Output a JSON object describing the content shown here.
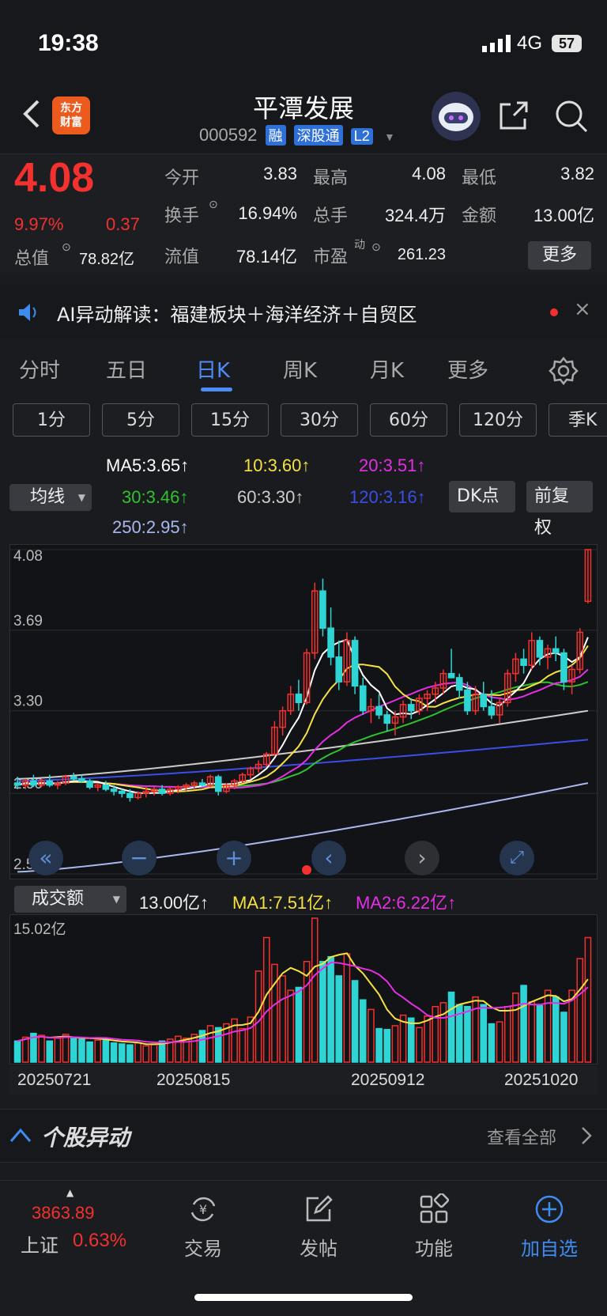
{
  "status": {
    "time": "19:38",
    "network": "4G",
    "battery": "57"
  },
  "header": {
    "back_icon": "chevron-left-icon",
    "logo_line1": "东方",
    "logo_line2": "财富",
    "title": "平潭发展",
    "code": "000592",
    "tags": [
      "融",
      "深股通",
      "L2"
    ]
  },
  "quote": {
    "price": "4.08",
    "change_pct": "9.97%",
    "change": "0.37",
    "open_label": "今开",
    "open": "3.83",
    "high_label": "最高",
    "high": "4.08",
    "low_label": "最低",
    "low": "3.82",
    "turnover_label": "换手",
    "turnover": "16.94%",
    "volume_label": "总手",
    "volume": "324.4万",
    "amount_label": "金额",
    "amount": "13.00亿",
    "mktcap_label": "总值",
    "mktcap": "78.82亿",
    "float_label": "流值",
    "float": "78.14亿",
    "pe_label": "市盈",
    "pe_sup": "动",
    "pe": "261.23",
    "more": "更多"
  },
  "ai": {
    "text": "AI异动解读：福建板块＋海洋经济＋自贸区"
  },
  "tabs": [
    "分时",
    "五日",
    "日K",
    "周K",
    "月K",
    "更多"
  ],
  "periods": [
    "1分",
    "5分",
    "15分",
    "30分",
    "60分",
    "120分",
    "季K"
  ],
  "ma": {
    "selector": "均线",
    "ma5": "MA5:3.65↑",
    "ma10": "10:3.60↑",
    "ma20": "20:3.51↑",
    "ma30": "30:3.46↑",
    "ma60": "60:3.30↑",
    "ma120": "120:3.16↑",
    "ma250": "250:2.95↑",
    "dk": "DK点",
    "fq": "前复权"
  },
  "colors": {
    "up": "#f3312e",
    "down": "#2ed5d5",
    "ma5": "#ffffff",
    "ma10": "#f5e142",
    "ma20": "#e62ee6",
    "ma30": "#2ec22e",
    "ma60": "#cccccc",
    "ma120": "#3a4ee8",
    "ma250": "#aab8f0",
    "accent": "#4e8cf5"
  },
  "chart_data": [
    {
      "type": "candlestick",
      "ylim": [
        2.51,
        4.08
      ],
      "y_ticks": [
        "4.08",
        "3.69",
        "3.30",
        "2.90",
        "2.51"
      ],
      "ohlc": [
        [
          2.95,
          2.98,
          2.92,
          2.94
        ],
        [
          2.94,
          2.97,
          2.92,
          2.96
        ],
        [
          2.96,
          2.99,
          2.93,
          2.94
        ],
        [
          2.94,
          2.97,
          2.93,
          2.96
        ],
        [
          2.96,
          2.99,
          2.93,
          2.94
        ],
        [
          2.94,
          2.96,
          2.92,
          2.95
        ],
        [
          2.95,
          2.99,
          2.94,
          2.98
        ],
        [
          2.98,
          3.0,
          2.96,
          2.97
        ],
        [
          2.97,
          2.99,
          2.95,
          2.96
        ],
        [
          2.96,
          2.97,
          2.92,
          2.93
        ],
        [
          2.93,
          2.95,
          2.91,
          2.94
        ],
        [
          2.94,
          2.96,
          2.91,
          2.92
        ],
        [
          2.92,
          2.94,
          2.89,
          2.91
        ],
        [
          2.91,
          2.92,
          2.88,
          2.9
        ],
        [
          2.9,
          2.92,
          2.86,
          2.88
        ],
        [
          2.88,
          2.91,
          2.87,
          2.9
        ],
        [
          2.9,
          2.93,
          2.88,
          2.91
        ],
        [
          2.91,
          2.93,
          2.89,
          2.92
        ],
        [
          2.92,
          2.94,
          2.89,
          2.9
        ],
        [
          2.9,
          2.93,
          2.89,
          2.92
        ],
        [
          2.92,
          2.94,
          2.9,
          2.93
        ],
        [
          2.93,
          2.95,
          2.91,
          2.94
        ],
        [
          2.94,
          2.96,
          2.92,
          2.95
        ],
        [
          2.95,
          2.97,
          2.93,
          2.94
        ],
        [
          2.94,
          2.99,
          2.93,
          2.98
        ],
        [
          2.98,
          2.99,
          2.89,
          2.91
        ],
        [
          2.91,
          2.95,
          2.9,
          2.94
        ],
        [
          2.94,
          2.97,
          2.92,
          2.96
        ],
        [
          2.96,
          3.0,
          2.95,
          2.99
        ],
        [
          2.99,
          3.03,
          2.97,
          3.02
        ],
        [
          3.02,
          3.06,
          3.0,
          3.04
        ],
        [
          3.04,
          3.1,
          3.03,
          3.09
        ],
        [
          3.09,
          3.25,
          3.08,
          3.22
        ],
        [
          3.22,
          3.32,
          3.18,
          3.3
        ],
        [
          3.3,
          3.42,
          3.28,
          3.38
        ],
        [
          3.38,
          3.45,
          3.3,
          3.34
        ],
        [
          3.34,
          3.6,
          3.33,
          3.58
        ],
        [
          3.58,
          3.92,
          3.55,
          3.88
        ],
        [
          3.88,
          3.94,
          3.66,
          3.7
        ],
        [
          3.7,
          3.8,
          3.52,
          3.56
        ],
        [
          3.56,
          3.64,
          3.4,
          3.44
        ],
        [
          3.44,
          3.68,
          3.42,
          3.64
        ],
        [
          3.64,
          3.66,
          3.38,
          3.42
        ],
        [
          3.42,
          3.46,
          3.28,
          3.3
        ],
        [
          3.3,
          3.36,
          3.24,
          3.32
        ],
        [
          3.32,
          3.38,
          3.26,
          3.28
        ],
        [
          3.28,
          3.3,
          3.2,
          3.24
        ],
        [
          3.24,
          3.3,
          3.18,
          3.27
        ],
        [
          3.27,
          3.35,
          3.24,
          3.33
        ],
        [
          3.33,
          3.36,
          3.26,
          3.3
        ],
        [
          3.3,
          3.38,
          3.28,
          3.36
        ],
        [
          3.36,
          3.4,
          3.3,
          3.38
        ],
        [
          3.38,
          3.44,
          3.34,
          3.41
        ],
        [
          3.41,
          3.5,
          3.38,
          3.48
        ],
        [
          3.48,
          3.6,
          3.46,
          3.46
        ],
        [
          3.46,
          3.48,
          3.36,
          3.4
        ],
        [
          3.4,
          3.44,
          3.28,
          3.3
        ],
        [
          3.3,
          3.42,
          3.28,
          3.38
        ],
        [
          3.38,
          3.44,
          3.3,
          3.32
        ],
        [
          3.32,
          3.4,
          3.26,
          3.28
        ],
        [
          3.28,
          3.36,
          3.24,
          3.34
        ],
        [
          3.34,
          3.5,
          3.32,
          3.48
        ],
        [
          3.48,
          3.58,
          3.44,
          3.55
        ],
        [
          3.55,
          3.6,
          3.48,
          3.52
        ],
        [
          3.52,
          3.68,
          3.5,
          3.64
        ],
        [
          3.64,
          3.66,
          3.52,
          3.56
        ],
        [
          3.56,
          3.62,
          3.5,
          3.6
        ],
        [
          3.6,
          3.66,
          3.54,
          3.58
        ],
        [
          3.58,
          3.6,
          3.4,
          3.44
        ],
        [
          3.44,
          3.52,
          3.38,
          3.5
        ],
        [
          3.5,
          3.7,
          3.48,
          3.68
        ],
        [
          3.83,
          4.08,
          3.82,
          4.08
        ]
      ]
    },
    {
      "type": "bar",
      "title": "成交额",
      "y_top_label": "15.02亿",
      "values": [
        2.2,
        2.6,
        3.0,
        2.8,
        2.2,
        2.5,
        2.9,
        2.6,
        2.4,
        2.1,
        2.3,
        2.5,
        2.0,
        1.9,
        1.8,
        2.0,
        1.7,
        1.9,
        2.2,
        2.4,
        2.7,
        2.5,
        2.9,
        3.3,
        3.8,
        3.6,
        4.0,
        4.5,
        3.5,
        4.7,
        9.5,
        13.0,
        10.2,
        9.0,
        7.5,
        7.8,
        10.5,
        15.02,
        10.5,
        11.0,
        9.0,
        11.3,
        8.5,
        6.5,
        5.5,
        3.5,
        3.4,
        3.8,
        4.9,
        4.6,
        3.6,
        4.8,
        5.8,
        6.2,
        7.3,
        6.0,
        5.8,
        6.8,
        6.0,
        4.0,
        4.2,
        5.8,
        7.2,
        8.0,
        6.3,
        5.9,
        7.5,
        6.8,
        5.2,
        7.5,
        10.8,
        13.0
      ],
      "ma1": "MA1:7.51亿↑",
      "ma2": "MA2:6.22亿↑",
      "current": "13.00亿↑",
      "x_ticks": [
        "20250721",
        "20250815",
        "20250912",
        "20251020"
      ]
    }
  ],
  "section": {
    "title": "个股异动",
    "link": "查看全部"
  },
  "nav": {
    "index_value": "3863.89",
    "index_name": "上证",
    "index_pct": "0.63%",
    "trade": "交易",
    "post": "发帖",
    "func": "功能",
    "watch": "加自选"
  }
}
